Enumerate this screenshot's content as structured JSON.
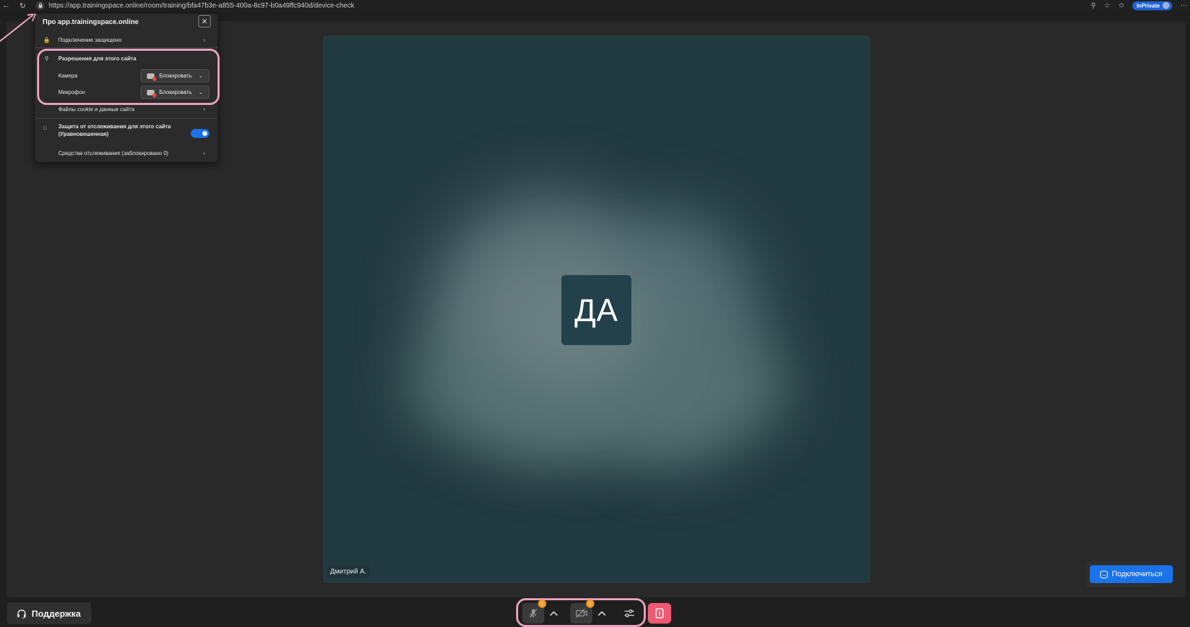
{
  "browser": {
    "url": "https://app.trainingspace.online/room/training/bfa47b3e-a855-400a-8c97-b0a49ffc940d/device-check",
    "inprivate_label": "InPrivate"
  },
  "site_info": {
    "title": "Про app.trainingspace.online",
    "connection": "Подключение защищено",
    "permissions_heading": "Разрешения для этого сайта",
    "camera_label": "Камера",
    "camera_value": "Блокировать",
    "microphone_label": "Микрофон",
    "microphone_value": "Блокировать",
    "cookies": "Файлы cookie и данные сайта",
    "tracking_line1": "Защита от отслеживания для этого сайта",
    "tracking_line2": "(Уравновешенная)",
    "tracking_enabled": true,
    "trackers": "Средства отслеживания (заблокировано 0)"
  },
  "preview": {
    "initials": "ДА",
    "name": "Дмитрий А."
  },
  "join_label": "Подключиться",
  "support_label": "Поддержка",
  "controls": {
    "mic_warning": "!",
    "cam_warning": "!"
  },
  "colors": {
    "accent": "#1a73e8",
    "highlight": "#e8a2be",
    "warning": "#f39a1e",
    "leave": "#ee5a72"
  }
}
